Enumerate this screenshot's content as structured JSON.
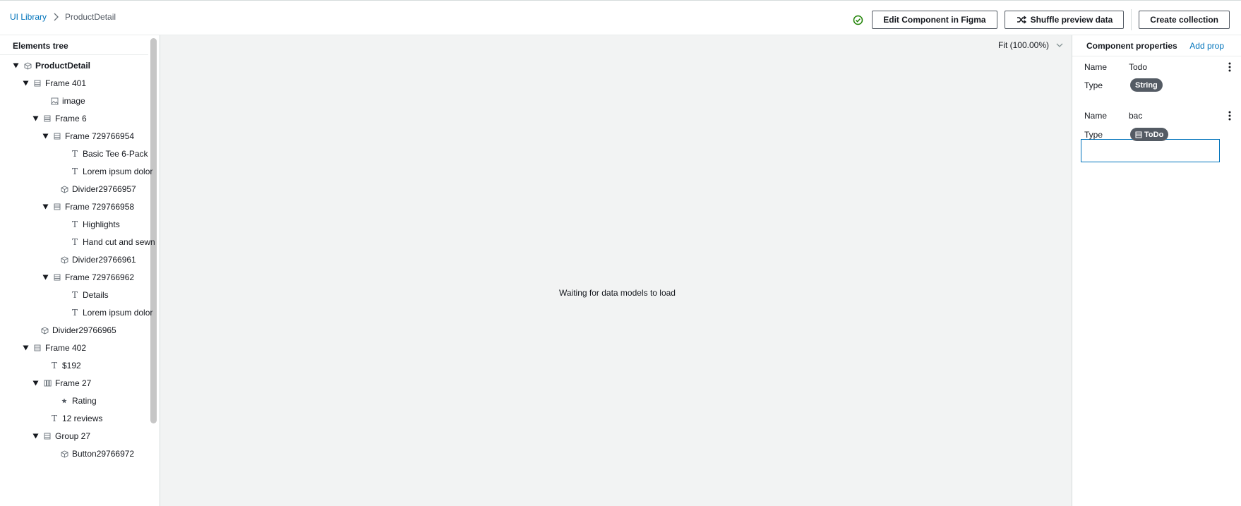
{
  "breadcrumb": {
    "root": "UI Library",
    "current": "ProductDetail"
  },
  "header": {
    "status_icon": "check-circle-icon",
    "edit_button": "Edit Component in Figma",
    "shuffle_button": "Shuffle preview data",
    "create_button": "Create collection"
  },
  "tree": {
    "title": "Elements tree",
    "items": [
      {
        "label": "ProductDetail",
        "icon": "component-icon",
        "expandable": true
      },
      {
        "label": "Frame 401",
        "icon": "frame-icon",
        "expandable": true
      },
      {
        "label": "image",
        "icon": "image-icon",
        "expandable": false
      },
      {
        "label": "Frame 6",
        "icon": "frame-icon",
        "expandable": true
      },
      {
        "label": "Frame 729766954",
        "icon": "frame-icon",
        "expandable": true
      },
      {
        "label": "Basic Tee 6-Pack",
        "icon": "text-icon",
        "expandable": false
      },
      {
        "label": "Lorem ipsum dolor",
        "icon": "text-icon",
        "expandable": false
      },
      {
        "label": "Divider29766957",
        "icon": "component-icon",
        "expandable": false
      },
      {
        "label": "Frame 729766958",
        "icon": "frame-icon",
        "expandable": true
      },
      {
        "label": "Highlights",
        "icon": "text-icon",
        "expandable": false
      },
      {
        "label": "Hand cut and sewn",
        "icon": "text-icon",
        "expandable": false
      },
      {
        "label": "Divider29766961",
        "icon": "component-icon",
        "expandable": false
      },
      {
        "label": "Frame 729766962",
        "icon": "frame-icon",
        "expandable": true
      },
      {
        "label": "Details",
        "icon": "text-icon",
        "expandable": false
      },
      {
        "label": "Lorem ipsum dolor",
        "icon": "text-icon",
        "expandable": false
      },
      {
        "label": "Divider29766965",
        "icon": "component-icon",
        "expandable": false
      },
      {
        "label": "Frame 402",
        "icon": "frame-icon",
        "expandable": true
      },
      {
        "label": "$192",
        "icon": "text-icon",
        "expandable": false
      },
      {
        "label": "Frame 27",
        "icon": "columns-icon",
        "expandable": true
      },
      {
        "label": "Rating",
        "icon": "star-icon",
        "expandable": false
      },
      {
        "label": "12 reviews",
        "icon": "text-icon",
        "expandable": false
      },
      {
        "label": "Group 27",
        "icon": "frame-icon",
        "expandable": true
      },
      {
        "label": "Button29766972",
        "icon": "component-icon",
        "expandable": false
      }
    ]
  },
  "canvas": {
    "zoom_label": "Fit (100.00%)",
    "message": "Waiting for data models to load"
  },
  "properties": {
    "title": "Component properties",
    "add_label": "Add prop",
    "name_label": "Name",
    "type_label": "Type",
    "props": [
      {
        "name": "Todo",
        "type": "String"
      },
      {
        "name": "bac",
        "type": "ToDo"
      }
    ]
  },
  "colors": {
    "link": "#0073bb",
    "badge": "#545b64",
    "success": "#1d8102"
  }
}
